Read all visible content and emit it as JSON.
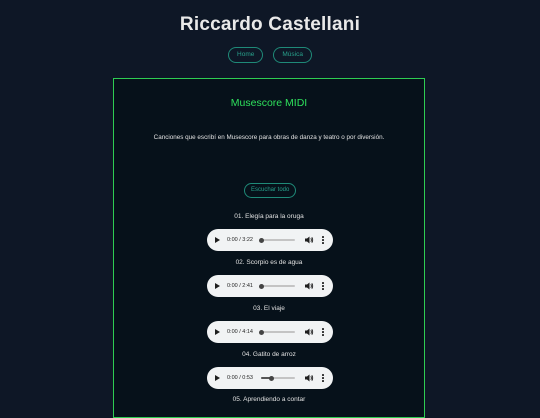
{
  "site": {
    "title": "Riccardo Castellani"
  },
  "nav": {
    "items": [
      {
        "label": "Home"
      },
      {
        "label": "Música"
      }
    ]
  },
  "panel": {
    "title": "Musescore MIDI",
    "description": "Canciones que escribí en Musescore para obras de danza y teatro o por diversión.",
    "listen_all_label": "Escuchar todo"
  },
  "colors": {
    "background": "#0e1726",
    "accent_green": "#2ee05c",
    "accent_teal": "#28a08b",
    "player_bg": "#f1f3f4"
  },
  "tracks": [
    {
      "title": "01. Elegía para la oruga",
      "time": "0:00 / 3:22",
      "progress": 0
    },
    {
      "title": "02. Scorpio es de agua",
      "time": "0:00 / 2:41",
      "progress": 0
    },
    {
      "title": "03. El viaje",
      "time": "0:00 / 4:14",
      "progress": 0
    },
    {
      "title": "04. Gatito de arroz",
      "time": "0:00 / 0:53",
      "progress": 0.3
    },
    {
      "title": "05. Aprendiendo a contar",
      "time": "",
      "progress": 0
    }
  ],
  "icons": {
    "play": "play-icon",
    "volume": "volume-icon",
    "menu": "more-vert-icon"
  }
}
